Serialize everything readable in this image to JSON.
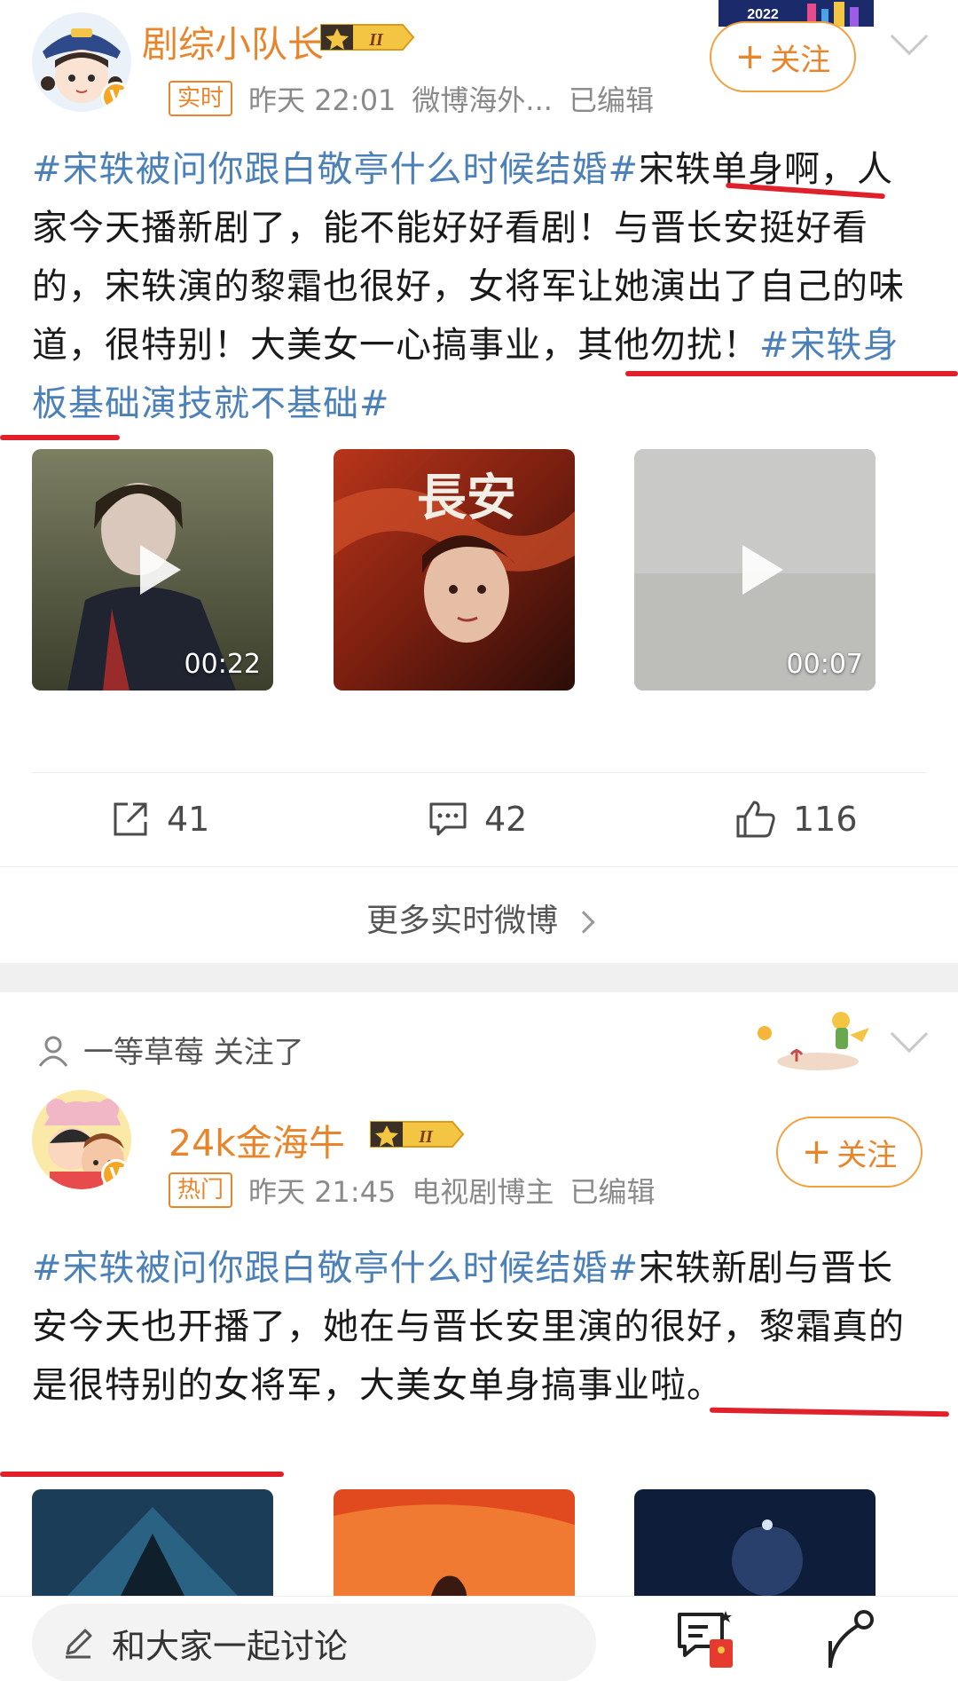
{
  "post1": {
    "username": "剧综小队长",
    "level": "II",
    "tag": "实时",
    "time": "昨天 22:01",
    "source": "微博海外...",
    "edited": "已编辑",
    "follow_label": "关注",
    "badge_year": "2022",
    "hashtag1": "#宋轶被问你跟白敬亭什么时候结婚#",
    "text_part1": "宋轶单身啊，人家今天播新剧了，能不能好好看剧！与晋长安挺好看的，宋轶演的黎霜也很好，女将军让她演出了自己的味道，很特别！大美女一心搞事业，其他勿扰！",
    "hashtag2": "#宋轶身板基础演技就不基础#",
    "media": [
      {
        "type": "video",
        "duration": "00:22"
      },
      {
        "type": "image",
        "poster_text": "長安"
      },
      {
        "type": "video",
        "duration": "00:07"
      }
    ],
    "actions": {
      "repost": "41",
      "comment": "42",
      "like": "116"
    },
    "more_label": "更多实时微博"
  },
  "post2": {
    "notice": "一等草莓 关注了",
    "username": "24k金海牛",
    "level": "II",
    "tag": "热门",
    "time": "昨天 21:45",
    "source": "电视剧博主",
    "edited": "已编辑",
    "follow_label": "关注",
    "hashtag1": "#宋轶被问你跟白敬亭什么时候结婚#",
    "text_part1": "宋轶新剧与晋长安今天也开播了，她在与晋长安里演的很好，黎霜真的是很特别的女将军，大美女单身搞事业啦。"
  },
  "bottom": {
    "input_placeholder": "和大家一起讨论"
  },
  "colors": {
    "accent": "#e8852b",
    "hashtag": "#4b80b8",
    "annotation": "#e0202a"
  }
}
